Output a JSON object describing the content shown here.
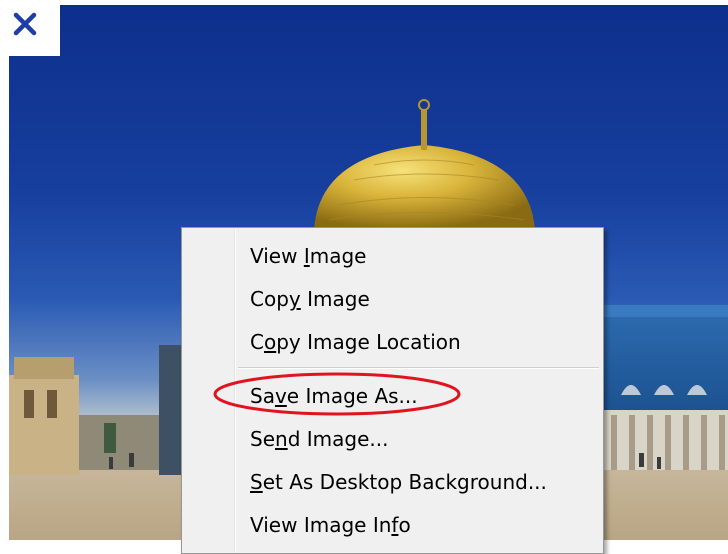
{
  "close_icon": "close-icon",
  "colors": {
    "close_icon": "#1f3ca8",
    "highlight_ellipse": "#e0141e",
    "menu_background": "#f0f0f0"
  },
  "context_menu": {
    "items": [
      {
        "label_pre": "View ",
        "mnemonic": "I",
        "label_post": "mage"
      },
      {
        "label_pre": "Cop",
        "mnemonic": "y",
        "label_post": " Image"
      },
      {
        "label_pre": "C",
        "mnemonic": "o",
        "label_post": "py Image Location"
      },
      {
        "label_pre": "Sa",
        "mnemonic": "v",
        "label_post": "e Image As..."
      },
      {
        "label_pre": "Se",
        "mnemonic": "n",
        "label_post": "d Image..."
      },
      {
        "label_pre": "",
        "mnemonic": "S",
        "label_post": "et As Desktop Background..."
      },
      {
        "label_pre": "View Image In",
        "mnemonic": "f",
        "label_post": "o"
      }
    ]
  }
}
